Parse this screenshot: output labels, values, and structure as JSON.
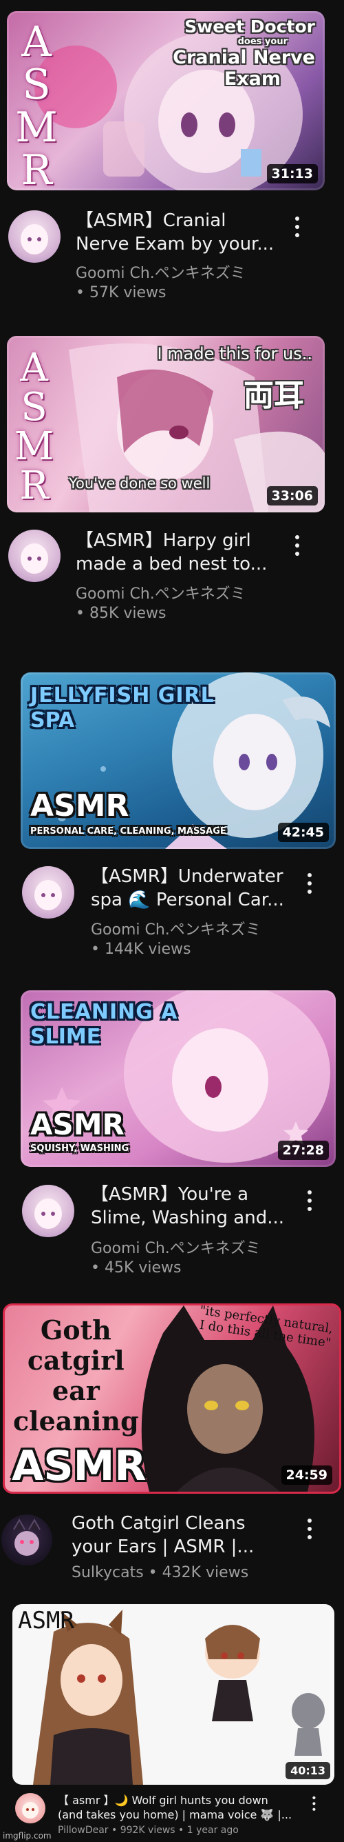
{
  "videos": [
    {
      "title_line1": "【ASMR】Cranial",
      "title_line2": "Nerve Exam by your...",
      "channel": "Goomi Ch.ペンキネズミ",
      "views": "• 57K views",
      "duration": "31:13",
      "thumb_text": {
        "asmr": "ASMR",
        "line1": "Sweet Doctor",
        "line2": "does your",
        "line3": "Cranial Nerve",
        "line4": "Exam"
      }
    },
    {
      "title_line1": "【ASMR】Harpy girl",
      "title_line2": "made a bed nest to...",
      "channel": "Goomi Ch.ペンキネズミ",
      "views": "• 85K views",
      "duration": "33:06",
      "thumb_text": {
        "asmr": "ASMR",
        "line1": "I made this for us..",
        "line2": "両耳",
        "line3": "You've done so well"
      }
    },
    {
      "title_line1": "【ASMR】Underwater",
      "title_line2": "spa 🌊 Personal Car...",
      "channel": "Goomi Ch.ペンキネズミ",
      "views": "• 144K views",
      "duration": "42:45",
      "thumb_text": {
        "line1": "JELLYFISH GIRL",
        "line2": "SPA",
        "asmr": "ASMR",
        "sub": "PERSONAL CARE, CLEANING, MASSAGE"
      }
    },
    {
      "title_line1": "【ASMR】You're a",
      "title_line2": "Slime, Washing and...",
      "channel": "Goomi Ch.ペンキネズミ",
      "views": "• 45K views",
      "duration": "27:28",
      "thumb_text": {
        "line1": "CLEANING A",
        "line2": "SLIME",
        "asmr": "ASMR",
        "sub": "SQUISHY, WASHING"
      }
    },
    {
      "title_line1": "Goth Catgirl Cleans",
      "title_line2": "your Ears | ASMR |...",
      "channel": "Sulkycats • 432K views",
      "duration": "24:59",
      "thumb_text": {
        "line1": "Goth",
        "line2": "catgirl",
        "line3": "ear",
        "line4": "cleaning",
        "asmr": "ASMR",
        "quote1": "\"its perfectly natural,",
        "quote2": "I do this all the time\""
      }
    },
    {
      "title_line1": "【 asmr 】🌙 Wolf girl hunts you down",
      "title_line2": "(and takes you home) | mama voice 🐺 |...",
      "channel": "PillowDear • 992K views • 1 year ago",
      "duration": "40:13",
      "thumb_text": {
        "asmr": "ASMR"
      }
    }
  ],
  "footer": {
    "watermark": "imgflip.com"
  },
  "colors": {
    "background": "#0f0f0f",
    "title": "#f1f1f1",
    "secondary": "#9e9e9e"
  }
}
